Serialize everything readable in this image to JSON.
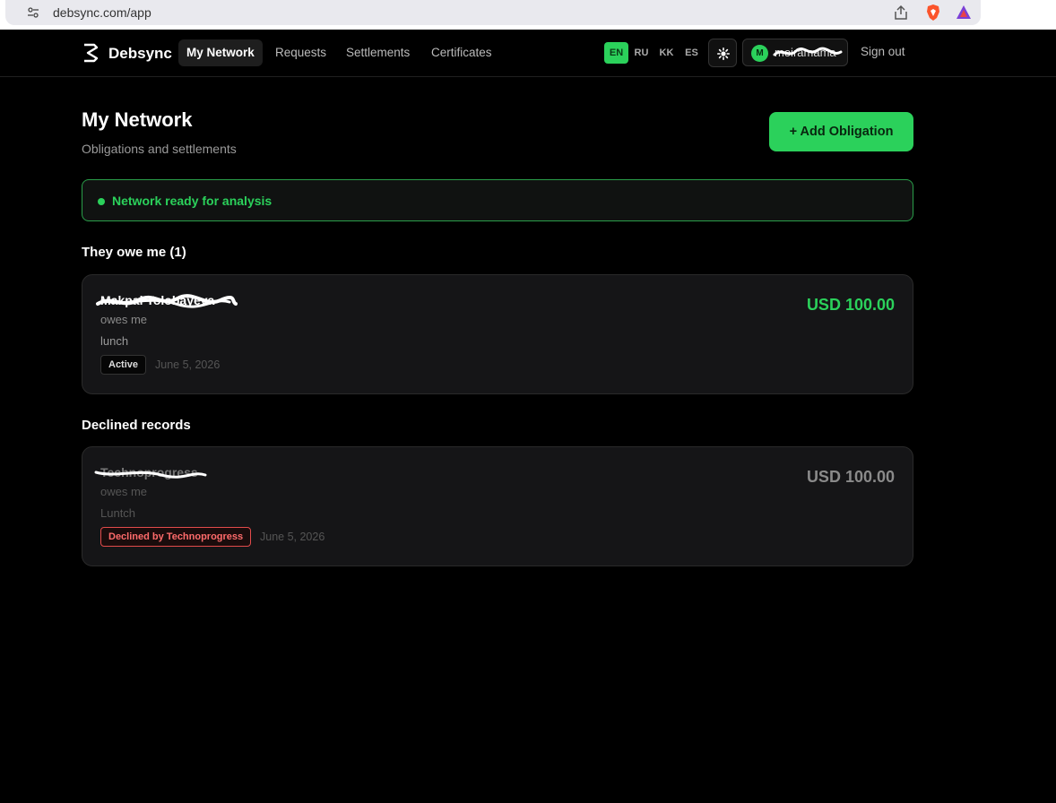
{
  "browser": {
    "url": "debsync.com/app"
  },
  "nav": {
    "brand": "Debsync",
    "tabs": [
      "My Network",
      "Requests",
      "Settlements",
      "Certificates"
    ],
    "languages": [
      "EN",
      "RU",
      "KK",
      "ES"
    ],
    "active_language": "EN",
    "user_initial": "M",
    "username": "moiramama",
    "signout": "Sign out"
  },
  "main": {
    "title": "My Network",
    "subtitle": "Obligations and settlements",
    "add_button": "+ Add Obligation",
    "status": "Network ready for analysis",
    "owed_section": "They owe me (1)",
    "declined_section": "Declined records"
  },
  "owed_cards": [
    {
      "name": "Makpal Tolobayeva",
      "relation": "owes me",
      "note": "lunch",
      "badge": "Active",
      "date": "June 5, 2026",
      "amount": "USD 100.00"
    }
  ],
  "declined_cards": [
    {
      "name": "Technoprogress",
      "relation": "owes me",
      "note": "Luntch",
      "badge": "Declined by Technoprogress",
      "date": "June 5, 2026",
      "amount": "USD 100.00"
    }
  ],
  "colors": {
    "accent": "#2bd15b",
    "danger": "#e24b4b",
    "background": "#000000",
    "card": "#151517"
  }
}
